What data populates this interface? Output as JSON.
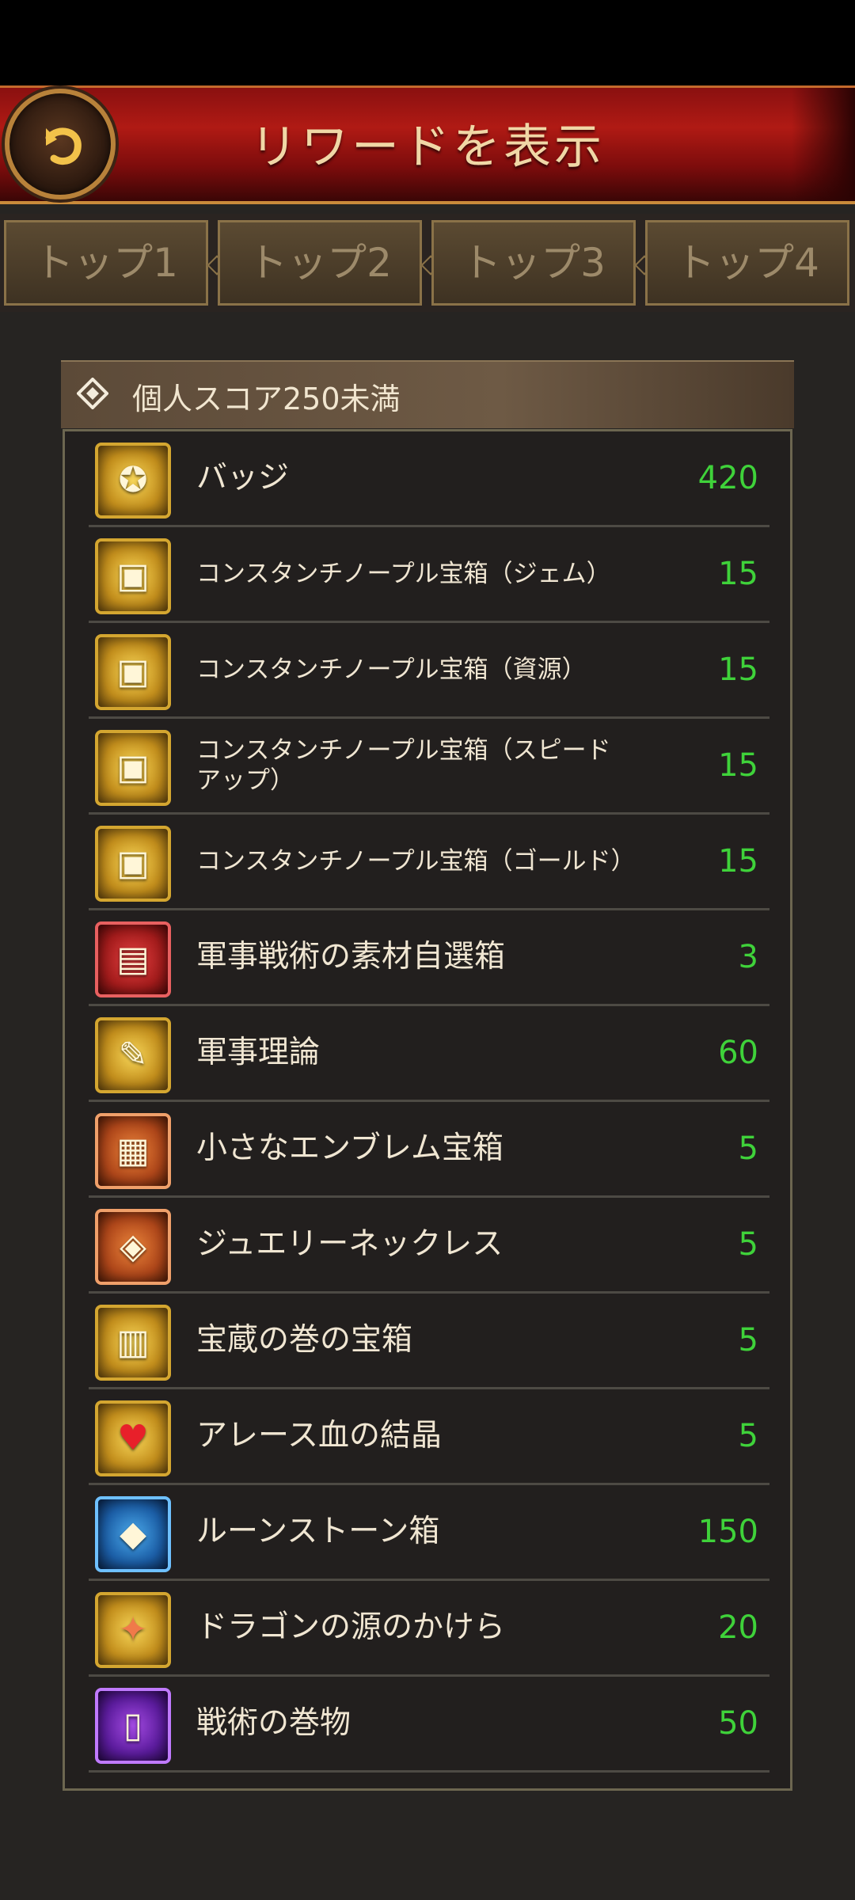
{
  "header": {
    "title": "リワードを表示"
  },
  "tabs": [
    {
      "label": "トップ1",
      "active": true
    },
    {
      "label": "トップ2",
      "active": false
    },
    {
      "label": "トップ3",
      "active": false
    },
    {
      "label": "トップ4",
      "active": false
    }
  ],
  "section": {
    "title": "個人スコア250未満"
  },
  "rewards": [
    {
      "name": "バッジ",
      "qty": "420",
      "icon": "badge-icon"
    },
    {
      "name": "コンスタンチノープル宝箱（ジェム）",
      "qty": "15",
      "icon": "gem-chest-icon"
    },
    {
      "name": "コンスタンチノープル宝箱（資源）",
      "qty": "15",
      "icon": "resource-chest-icon"
    },
    {
      "name": "コンスタンチノープル宝箱（スピードアップ）",
      "qty": "15",
      "icon": "speedup-chest-icon"
    },
    {
      "name": "コンスタンチノープル宝箱（ゴールド）",
      "qty": "15",
      "icon": "gold-chest-icon"
    },
    {
      "name": "軍事戦術の素材自選箱",
      "qty": "3",
      "icon": "material-chest-icon"
    },
    {
      "name": "軍事理論",
      "qty": "60",
      "icon": "scroll-icon"
    },
    {
      "name": "小さなエンブレム宝箱",
      "qty": "5",
      "icon": "emblem-chest-icon"
    },
    {
      "name": "ジュエリーネックレス",
      "qty": "5",
      "icon": "necklace-icon"
    },
    {
      "name": "宝蔵の巻の宝箱",
      "qty": "5",
      "icon": "treasure-chest-icon"
    },
    {
      "name": "アレース血の結晶",
      "qty": "5",
      "icon": "blood-crystal-icon"
    },
    {
      "name": "ルーンストーン箱",
      "qty": "150",
      "icon": "runestone-box-icon"
    },
    {
      "name": "ドラゴンの源のかけら",
      "qty": "20",
      "icon": "dragon-shard-icon"
    },
    {
      "name": "戦術の巻物",
      "qty": "50",
      "icon": "tactics-scroll-icon"
    }
  ],
  "colors": {
    "quantity": "#3fd23a",
    "accent": "#d4a630"
  }
}
